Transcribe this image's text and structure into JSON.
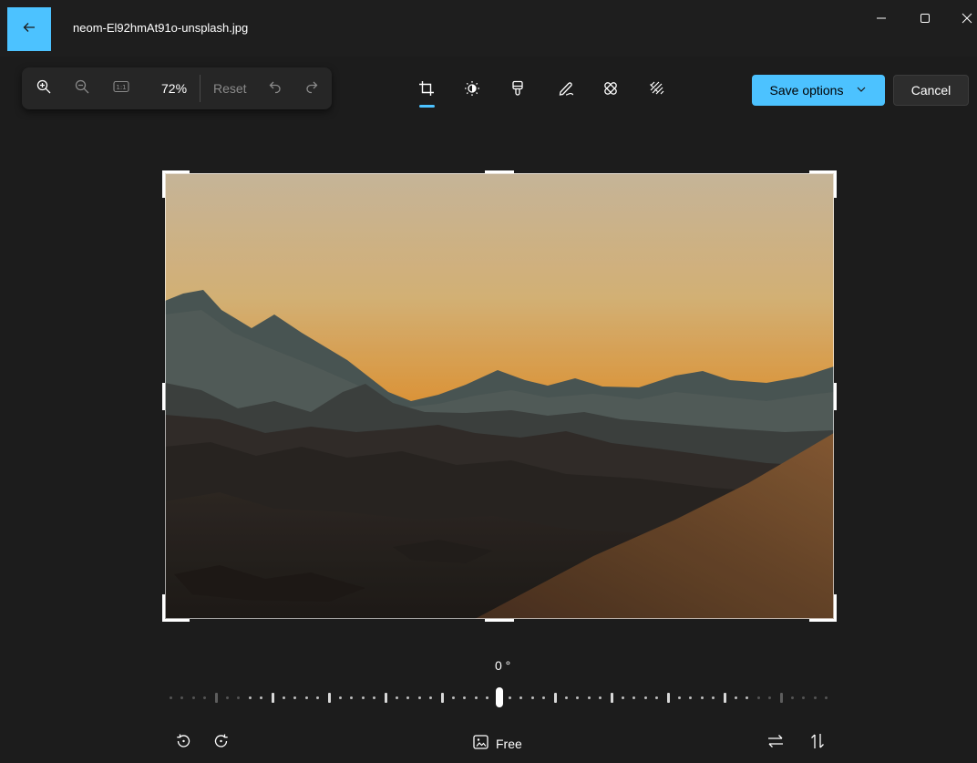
{
  "window": {
    "title": "neom-El92hmAt91o-unsplash.jpg",
    "minimize_icon": "minimize-icon",
    "maximize_icon": "maximize-icon",
    "close_icon": "close-icon"
  },
  "zoom_bar": {
    "zoom_level": "72%",
    "actual_size_label": "1:1",
    "reset_label": "Reset",
    "icons": [
      "zoom-in-icon",
      "zoom-out-icon",
      "actual-size-icon",
      "undo-icon",
      "redo-icon"
    ]
  },
  "tools": [
    {
      "name": "crop",
      "icon": "crop-icon",
      "active": true
    },
    {
      "name": "adjustment",
      "icon": "brightness-icon",
      "active": false
    },
    {
      "name": "filter",
      "icon": "filter-icon",
      "active": false
    },
    {
      "name": "markup",
      "icon": "markup-icon",
      "active": false
    },
    {
      "name": "retouch",
      "icon": "retouch-icon",
      "active": false
    },
    {
      "name": "background",
      "icon": "background-blur-icon",
      "active": false
    }
  ],
  "actions": {
    "save_label": "Save options",
    "cancel_label": "Cancel"
  },
  "crop": {
    "rotation_label": "0 °",
    "aspect_label": "Free",
    "rotation_value": 0
  },
  "colors": {
    "accent": "#4cc2ff",
    "background": "#1c1c1c"
  }
}
